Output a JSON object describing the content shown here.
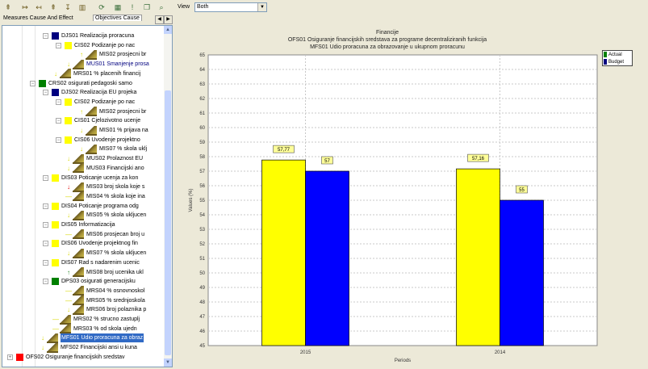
{
  "toolbar": {
    "icons": [
      "measure-add-icon",
      "measure-link-icon",
      "measure-link2-icon",
      "measure-add2-icon",
      "measure-edit-icon",
      "measure-chart-icon",
      "refresh-icon",
      "calendar-icon",
      "alert-icon",
      "copy-icon",
      "zoom-icon"
    ],
    "view_label": "View",
    "view_value": "Both"
  },
  "tabs": [
    "Measures Cause And Effect",
    "Objectives Cause"
  ],
  "tree": [
    {
      "level": 1,
      "kind": "square",
      "color": "#00007f",
      "label": "DJS01 Realizacija proracuna"
    },
    {
      "level": 2,
      "kind": "square",
      "color": "#ffff00",
      "label": "CIS02 Podizanje po nac"
    },
    {
      "level": 3,
      "kind": "measure",
      "arrow": "up",
      "label": "MIS02 prosjecni br"
    },
    {
      "level": 2,
      "kind": "measure",
      "arrow": "down",
      "label": "MUS01 Smanjenje prosa",
      "blue": true
    },
    {
      "level": 1,
      "kind": "measure",
      "arrow": "down",
      "label": "MRS01 % placenih financij"
    },
    {
      "level": 0,
      "kind": "square",
      "color": "#008000",
      "label": "CRS02 osigurati pedagoski samo"
    },
    {
      "level": 1,
      "kind": "square",
      "color": "#00007f",
      "label": "DJS02 Realizacija EU projeka"
    },
    {
      "level": 2,
      "kind": "square",
      "color": "#ffff00",
      "label": "CIS02 Podizanje po nac"
    },
    {
      "level": 3,
      "kind": "measure",
      "arrow": "up",
      "label": "MIS02 prosjecni br"
    },
    {
      "level": 2,
      "kind": "square",
      "color": "#ffff00",
      "label": "CIS01 Cjelozivotno ucenje"
    },
    {
      "level": 3,
      "kind": "measure",
      "arrow": "down",
      "label": "MIS01 % prijava na"
    },
    {
      "level": 2,
      "kind": "square",
      "color": "#ffff00",
      "label": "CIS06 Uvodenje projektno"
    },
    {
      "level": 3,
      "kind": "measure",
      "arrow": "down",
      "label": "MIS07 % skola uklj"
    },
    {
      "level": 2,
      "kind": "measure",
      "arrow": "down",
      "label": "MUS02 Prolaznost EU"
    },
    {
      "level": 2,
      "kind": "measure",
      "arrow": "down",
      "label": "MUS03 Financijski ano"
    },
    {
      "level": 1,
      "kind": "square",
      "color": "#ffff00",
      "label": "DIS03 Poticanje ucenja za kon"
    },
    {
      "level": 2,
      "kind": "measure",
      "arrow": "red",
      "label": "MIS03 broj skola koje s"
    },
    {
      "level": 2,
      "kind": "measure",
      "arrow": "flat",
      "label": "MIS04 % skola koje ina"
    },
    {
      "level": 1,
      "kind": "square",
      "color": "#ffff00",
      "label": "DIS04 Poticanje programa odg"
    },
    {
      "level": 2,
      "kind": "measure",
      "arrow": "down",
      "label": "MIS05 % skola ukljucen"
    },
    {
      "level": 1,
      "kind": "square",
      "color": "#ffff00",
      "label": "DIS05 Informatizacija"
    },
    {
      "level": 2,
      "kind": "measure",
      "arrow": "flat",
      "label": "MIS06 prosjecan broj u"
    },
    {
      "level": 1,
      "kind": "square",
      "color": "#ffff00",
      "label": "DIS06 Uvodenje projektnog fin"
    },
    {
      "level": 2,
      "kind": "measure",
      "arrow": "down",
      "label": "MIS07 % skola ukljucen"
    },
    {
      "level": 1,
      "kind": "square",
      "color": "#ffff00",
      "label": "DIS07 Rad s nadarenim ucenic"
    },
    {
      "level": 2,
      "kind": "measure",
      "arrow": "green",
      "label": "MIS08 broj ucenika ukl"
    },
    {
      "level": 1,
      "kind": "square",
      "color": "#008000",
      "label": "DPS03 osigurati generacijsku"
    },
    {
      "level": 2,
      "kind": "measure",
      "arrow": "flat",
      "label": "MRS04 % osnovnoskol"
    },
    {
      "level": 2,
      "kind": "measure",
      "arrow": "flat",
      "label": "MRS05 % srednjoskola"
    },
    {
      "level": 2,
      "kind": "measure",
      "arrow": "down",
      "label": "MRS06 broj polaznika p"
    },
    {
      "level": 1,
      "kind": "measure",
      "arrow": "flat",
      "label": "MRS02 % strucno zastuplj"
    },
    {
      "level": 1,
      "kind": "measure",
      "arrow": "flat",
      "label": "MRS03 % od skola ujedn"
    },
    {
      "level": 0,
      "kind": "measure",
      "arrow": "down",
      "label": "MFS01 Udio proracuna za obraz",
      "selected": true
    },
    {
      "level": 0,
      "kind": "measure",
      "arrow": "down",
      "label": "MFS02 Financijski ansi u kuna"
    },
    {
      "level": -1,
      "kind": "square",
      "color": "#ff0000",
      "label": "OFS02 Osiguranje financijskih sredstav"
    }
  ],
  "chart_data": {
    "type": "bar",
    "title": [
      "Financije",
      "OFS01 Osiguranje financijskih sredstava za programe decentraliziranih funkcija",
      "MFS01 Udio proracuna za obrazovanje u ukupnom proracunu"
    ],
    "xlabel": "Periods",
    "ylabel": "Values (%)",
    "ylim": [
      45,
      65
    ],
    "ystep": 1,
    "grid": true,
    "categories": [
      "2015",
      "2014"
    ],
    "series": [
      {
        "name": "Actual",
        "color": "#ffff00",
        "values": [
          57.77,
          57.16
        ]
      },
      {
        "name": "Budget",
        "color": "#0000ff",
        "values": [
          57,
          55
        ]
      }
    ],
    "data_labels": [
      [
        "57,77",
        "57"
      ],
      [
        "57,16",
        "55"
      ]
    ],
    "legend": "top-right"
  }
}
